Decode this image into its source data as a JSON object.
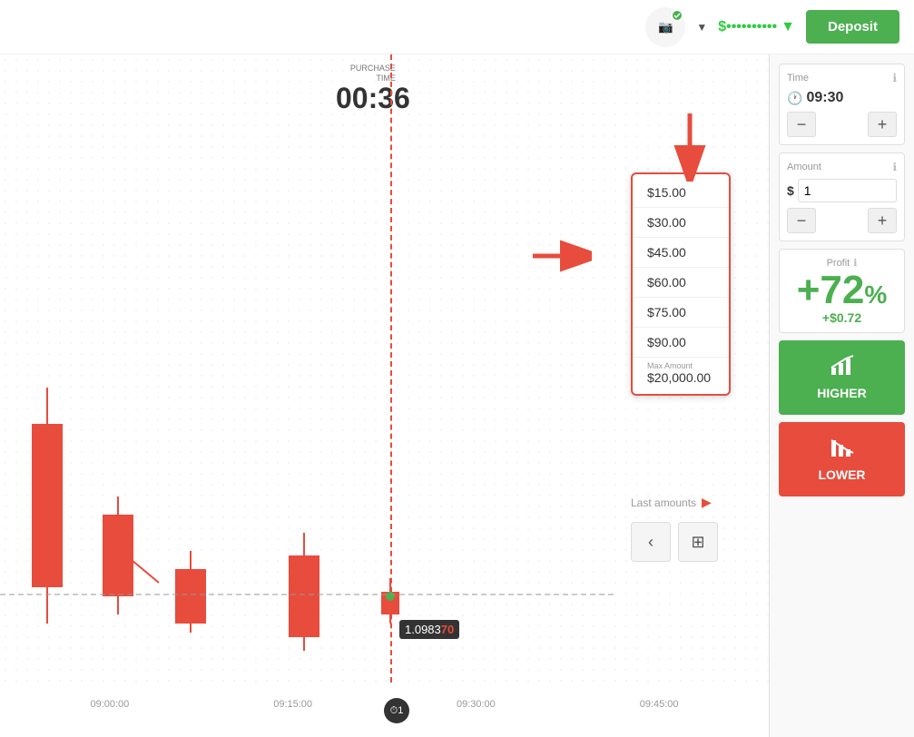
{
  "header": {
    "deposit_label": "Deposit",
    "balance_display": "$••••••••••",
    "dropdown_arrow": "▼"
  },
  "chart": {
    "purchase_time_label": "PURCHASE\nTIME",
    "purchase_time_value": "00:36",
    "price": "1.0983",
    "price_highlight": "70",
    "x_axis": [
      "09:00:00",
      "09:15:00",
      "09:30:00",
      "09:45:00"
    ],
    "timer_label": "⏱1"
  },
  "amount_dropdown": {
    "items": [
      "$15.00",
      "$30.00",
      "$45.00",
      "$60.00",
      "$75.00",
      "$90.00"
    ],
    "max_label": "Max Amount",
    "max_value": "$20,000.00",
    "last_amounts_label": "Last amounts"
  },
  "sidebar": {
    "time_section_label": "Time",
    "time_value": "09:30",
    "minus_label": "−",
    "plus_label": "+",
    "amount_section_label": "Amount",
    "amount_dollar": "$",
    "amount_value": "1",
    "profit_label": "Profit",
    "profit_percent": "+72",
    "profit_percent_sign": "%",
    "profit_dollar": "+$0.72",
    "higher_label": "HIGHER",
    "lower_label": "LOWER"
  },
  "icons": {
    "camera": "📷",
    "check": "✓",
    "clock": "🕐",
    "chart_up": "📈",
    "chart_down": "📉",
    "back": "‹",
    "calc": "⊞",
    "arrow_down": "▼",
    "info": "ℹ"
  }
}
